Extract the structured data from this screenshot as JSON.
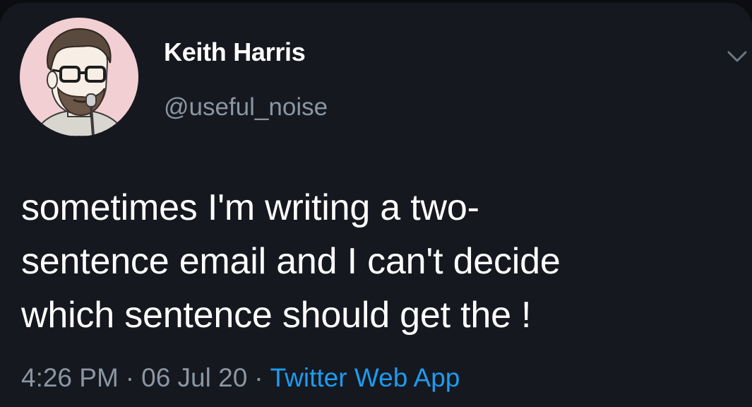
{
  "author": {
    "display_name": "Keith Harris",
    "handle": "@useful_noise",
    "avatar_icon": "cartoon-portrait-avatar"
  },
  "tweet": {
    "text": "sometimes I'm writing a two-\nsentence email and I can't decide\nwhich sentence should get the !",
    "time": "4:26 PM",
    "separator": "·",
    "date": "06 Jul 20",
    "source": "Twitter Web App"
  },
  "icons": {
    "menu": "chevron-down-icon"
  },
  "colors": {
    "background": "#16181f",
    "text": "#ffffff",
    "secondary_text": "#8b96a3",
    "link": "#1d9bf0",
    "avatar_bg": "#f1cfd2"
  }
}
